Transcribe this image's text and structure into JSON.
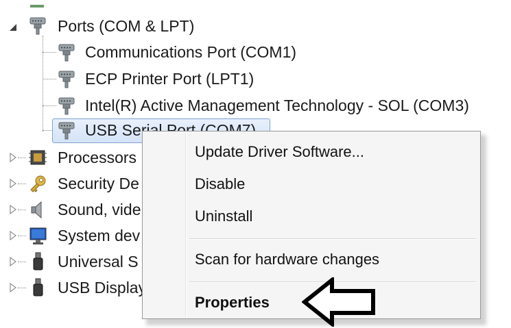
{
  "tree": {
    "ports": {
      "label": "Ports (COM & LPT)",
      "children": [
        "Communications Port (COM1)",
        "ECP Printer Port (LPT1)",
        "Intel(R) Active Management Technology - SOL (COM3)",
        "USB Serial Port (COM7)"
      ]
    },
    "categories": [
      "Processors",
      "Security De",
      "Sound, vide",
      "System dev",
      "Universal S",
      "USB Display"
    ]
  },
  "context_menu": {
    "items": [
      "Update Driver Software...",
      "Disable",
      "Uninstall",
      "Scan for hardware changes",
      "Properties"
    ]
  }
}
